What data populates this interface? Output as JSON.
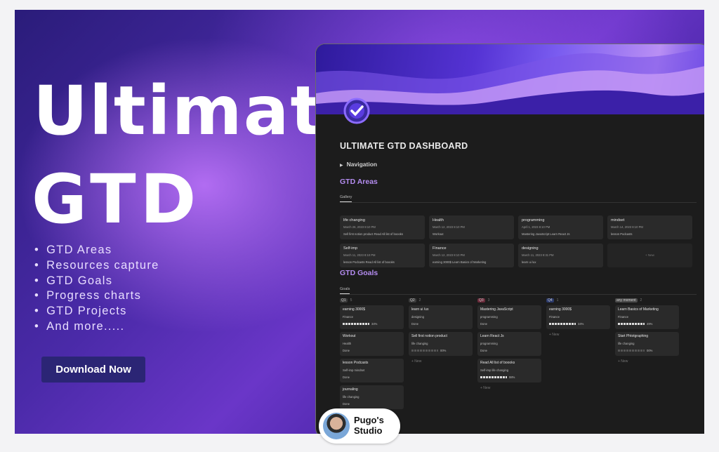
{
  "hero": {
    "title_line1": "Ultimate",
    "title_line2": "GTD",
    "features": [
      "GTD Areas",
      "Resources capture",
      "GTD Goals",
      "Progress charts",
      "GTD Projects",
      "And more....."
    ],
    "download_label": "Download Now"
  },
  "dashboard": {
    "title": "ULTIMATE GTD DASHBOARD",
    "nav_label": "Navigation",
    "areas_title": "GTD Areas",
    "areas_view": "Gallery",
    "areas": [
      {
        "name": "life changing",
        "date": "March 26, 2023 8:10 PM",
        "tags": "Sell first notion product   Read All list of boooks"
      },
      {
        "name": "Health",
        "date": "March 12, 2023 8:10 PM",
        "tags": "Workout"
      },
      {
        "name": "programming",
        "date": "April 1, 2023 8:10 PM",
        "tags": "Mastering JavaScript   Learn React Js"
      },
      {
        "name": "mindset",
        "date": "March 14, 2023 8:10 PM",
        "tags": "lesson Podcasts"
      },
      {
        "name": "Self-imp",
        "date": "March 11, 2023 8:10 PM",
        "tags": "lesson Podcasts   Read All list of boooks"
      },
      {
        "name": "Finance",
        "date": "March 12, 2023 8:10 PM",
        "tags": "earning 3000$   Learn Basics of Marketing"
      },
      {
        "name": "designing",
        "date": "March 11, 2023 8:31 PM",
        "tags": "learn ui /ux"
      }
    ],
    "new_label": "+ New",
    "goals_title": "GTD Goals",
    "goals_view": "Goals",
    "columns": [
      {
        "label": "Q1",
        "count": "5",
        "color": "#3a3a3a",
        "cards": [
          {
            "name": "earning 3000$",
            "area": "Finance",
            "status": "34%",
            "bar": "full"
          },
          {
            "name": "Workout",
            "area": "Health",
            "status": "Done",
            "bar": "none"
          },
          {
            "name": "lesson Podcasts",
            "area": "Self-imp   mindset",
            "status": "Done",
            "bar": "none"
          },
          {
            "name": "journaling",
            "area": "life changing",
            "status": "Done",
            "bar": "none"
          }
        ]
      },
      {
        "label": "Q2",
        "count": "2",
        "color": "#3a3a3a",
        "cards": [
          {
            "name": "learn ui /ux",
            "area": "designing",
            "status": "Done",
            "bar": "none"
          },
          {
            "name": "Sell first notion product",
            "area": "life changing",
            "status": "00%",
            "bar": "full"
          }
        ]
      },
      {
        "label": "Q3",
        "count": "3",
        "color": "#6b2a3a",
        "cards": [
          {
            "name": "Mastering JavaScript",
            "area": "programming",
            "status": "Done",
            "bar": "none"
          },
          {
            "name": "Learn React Js",
            "area": "programming",
            "status": "Done",
            "bar": "none"
          },
          {
            "name": "Read All list of boooks",
            "area": "Self-imp   life changing",
            "status": "98%",
            "bar": "full"
          }
        ]
      },
      {
        "label": "Q4",
        "count": "1",
        "color": "#2b3a6b",
        "cards": [
          {
            "name": "earning 3000$",
            "area": "Finance",
            "status": "34%",
            "bar": "full"
          }
        ]
      },
      {
        "label": "any moment",
        "count": "2",
        "color": "#4a4a4a",
        "cards": [
          {
            "name": "Learn Basics of Marketing",
            "area": "Finance",
            "status": "49%",
            "bar": "full"
          },
          {
            "name": "Start Phtotgraphing",
            "area": "life changing",
            "status": "00%",
            "bar": "full"
          }
        ]
      }
    ]
  },
  "studio": {
    "name_line1": "Pugo's",
    "name_line2": "Studio"
  }
}
